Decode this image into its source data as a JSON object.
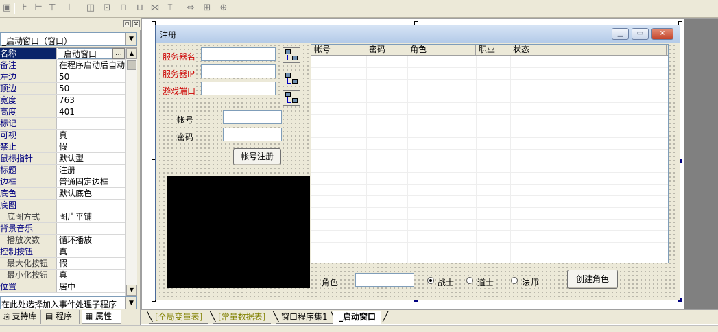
{
  "toolbar": {
    "icons": [
      "window-icon",
      "align-left-icon",
      "align-center-icon",
      "align-top-icon",
      "align-bottom-icon",
      "space-icon",
      "center-icon",
      "equal-width-icon",
      "equal-height-icon",
      "spacing-icon",
      "fit-icon",
      "size-icon",
      "grid-icon"
    ]
  },
  "panel": {
    "object_select": "_启动窗口（窗口）",
    "properties": [
      {
        "name": "名称",
        "value": "_启动窗口"
      },
      {
        "name": "备注",
        "value": "在程序启动后自动"
      },
      {
        "name": "左边",
        "value": "50"
      },
      {
        "name": "顶边",
        "value": "50"
      },
      {
        "name": "宽度",
        "value": "763"
      },
      {
        "name": "高度",
        "value": "401"
      },
      {
        "name": "标记",
        "value": ""
      },
      {
        "name": "可视",
        "value": "真"
      },
      {
        "name": "禁止",
        "value": "假"
      },
      {
        "name": "鼠标指针",
        "value": "默认型"
      },
      {
        "name": "标题",
        "value": "注册"
      },
      {
        "name": "边框",
        "value": "普通固定边框"
      },
      {
        "name": "底色",
        "value": "默认底色"
      },
      {
        "name": "底图",
        "value": ""
      },
      {
        "name": "底图方式",
        "value": "图片平铺"
      },
      {
        "name": "背景音乐",
        "value": ""
      },
      {
        "name": "播放次数",
        "value": "循环播放"
      },
      {
        "name": "控制按钮",
        "value": "真"
      },
      {
        "name": "最大化按钮",
        "value": "假"
      },
      {
        "name": "最小化按钮",
        "value": "真"
      },
      {
        "name": "位置",
        "value": "居中"
      }
    ],
    "event_select": "在此处选择加入事件处理子程序",
    "tabs": [
      "支持库",
      "程序",
      "属性"
    ]
  },
  "form": {
    "title": "注册",
    "labels": {
      "server_name": "服务器名",
      "server_ip": "服务器IP",
      "game_port": "游戏端口",
      "account": "帐号",
      "password": "密码",
      "role": "角色"
    },
    "register_button": "帐号注册",
    "create_role_button": "创建角色",
    "list_columns": [
      "帐号",
      "密码",
      "角色",
      "职业",
      "状态"
    ],
    "radios": [
      {
        "label": "战士",
        "checked": true
      },
      {
        "label": "道士",
        "checked": false
      },
      {
        "label": "法师",
        "checked": false
      }
    ]
  },
  "bottom_tabs": [
    "[全局变量表]",
    "[常量数据表]",
    "窗口程序集1",
    "_启动窗口"
  ]
}
